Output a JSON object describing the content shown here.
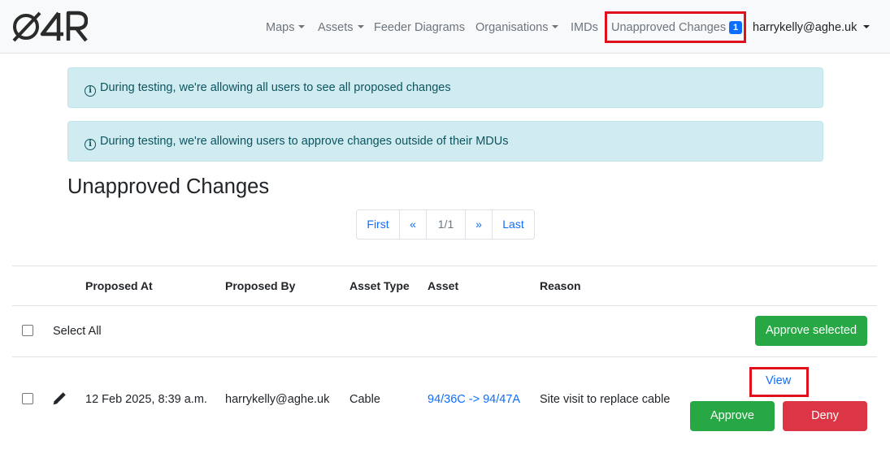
{
  "app": {
    "logo_text": "O4R"
  },
  "nav": {
    "maps": "Maps",
    "assets": "Assets",
    "feeder_diagrams": "Feeder Diagrams",
    "organisations": "Organisations",
    "imds": "IMDs",
    "unapproved_changes": "Unapproved Changes",
    "unapproved_count": "1",
    "user": "harrykelly@aghe.uk"
  },
  "alerts": {
    "see_all": "During testing, we're allowing all users to see all proposed changes",
    "approve_outside": "During testing, we're allowing users to approve changes outside of their MDUs"
  },
  "page": {
    "title": "Unapproved Changes"
  },
  "pagination": {
    "first": "First",
    "prev": "«",
    "current": "1/1",
    "next": "»",
    "last": "Last"
  },
  "table": {
    "headers": {
      "proposed_at": "Proposed At",
      "proposed_by": "Proposed By",
      "asset_type": "Asset Type",
      "asset": "Asset",
      "reason": "Reason"
    },
    "select_all": "Select All",
    "approve_selected": "Approve selected",
    "rows": [
      {
        "proposed_at": "12 Feb 2025, 8:39 a.m.",
        "proposed_by": "harrykelly@aghe.uk",
        "asset_type": "Cable",
        "asset": "94/36C -> 94/47A",
        "reason": "Site visit to replace cable",
        "view": "View",
        "approve": "Approve",
        "deny": "Deny"
      }
    ]
  },
  "colors": {
    "primary": "#0d6efd",
    "success": "#28a745",
    "danger": "#dc3545",
    "highlight": "#e0101c",
    "alert_bg": "#d1ecf1"
  },
  "icons": {
    "edit": "pencil-icon",
    "info": "info-circle-icon"
  }
}
